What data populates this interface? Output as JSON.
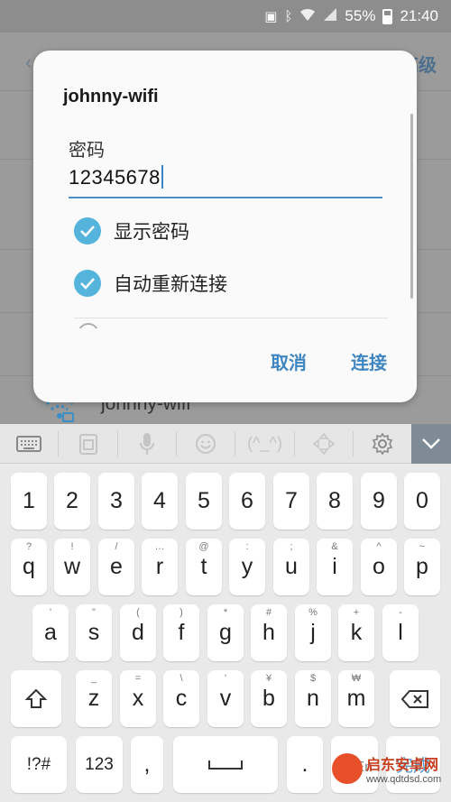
{
  "status_bar": {
    "battery_percent": "55%",
    "time": "21:40"
  },
  "background": {
    "back_glyph": "‹",
    "advanced_label": "高级",
    "wifi_name": "johnny-wifi"
  },
  "dialog": {
    "title": "johnny-wifi",
    "password_label": "密码",
    "password_value": "12345678",
    "show_password_label": "显示密码",
    "auto_reconnect_label": "自动重新连接",
    "cancel_label": "取消",
    "connect_label": "连接"
  },
  "keyboard": {
    "toolbar": {
      "emoticon_label": "(^_^)"
    },
    "row1": [
      "1",
      "2",
      "3",
      "4",
      "5",
      "6",
      "7",
      "8",
      "9",
      "0"
    ],
    "row2": [
      {
        "key": "q",
        "sub": "?"
      },
      {
        "key": "w",
        "sub": "!"
      },
      {
        "key": "e",
        "sub": "/"
      },
      {
        "key": "r",
        "sub": "…"
      },
      {
        "key": "t",
        "sub": "@"
      },
      {
        "key": "y",
        "sub": ":"
      },
      {
        "key": "u",
        "sub": ";"
      },
      {
        "key": "i",
        "sub": "&"
      },
      {
        "key": "o",
        "sub": "^"
      },
      {
        "key": "p",
        "sub": "~"
      }
    ],
    "row3": [
      {
        "key": "a",
        "sub": "'"
      },
      {
        "key": "s",
        "sub": "\""
      },
      {
        "key": "d",
        "sub": "("
      },
      {
        "key": "f",
        "sub": ")"
      },
      {
        "key": "g",
        "sub": "*"
      },
      {
        "key": "h",
        "sub": "#"
      },
      {
        "key": "j",
        "sub": "%"
      },
      {
        "key": "k",
        "sub": "+"
      },
      {
        "key": "l",
        "sub": "-"
      }
    ],
    "row4": [
      {
        "key": "z",
        "sub": "_"
      },
      {
        "key": "x",
        "sub": "="
      },
      {
        "key": "c",
        "sub": "\\"
      },
      {
        "key": "v",
        "sub": "'"
      },
      {
        "key": "b",
        "sub": "¥"
      },
      {
        "key": "n",
        "sub": "$"
      },
      {
        "key": "m",
        "sub": "₩"
      }
    ],
    "symbols_label": "!?#",
    "numbers_label": "123",
    "comma_label": ",",
    "period_label": ".",
    "lang_label": "中/En",
    "done_label": "完成"
  },
  "watermark": {
    "title": "启东安卓网",
    "url": "www.qdtdsd.com"
  },
  "colors": {
    "accent": "#55b4db",
    "button_text": "#3f86c1",
    "underline": "#4a8fc9"
  }
}
